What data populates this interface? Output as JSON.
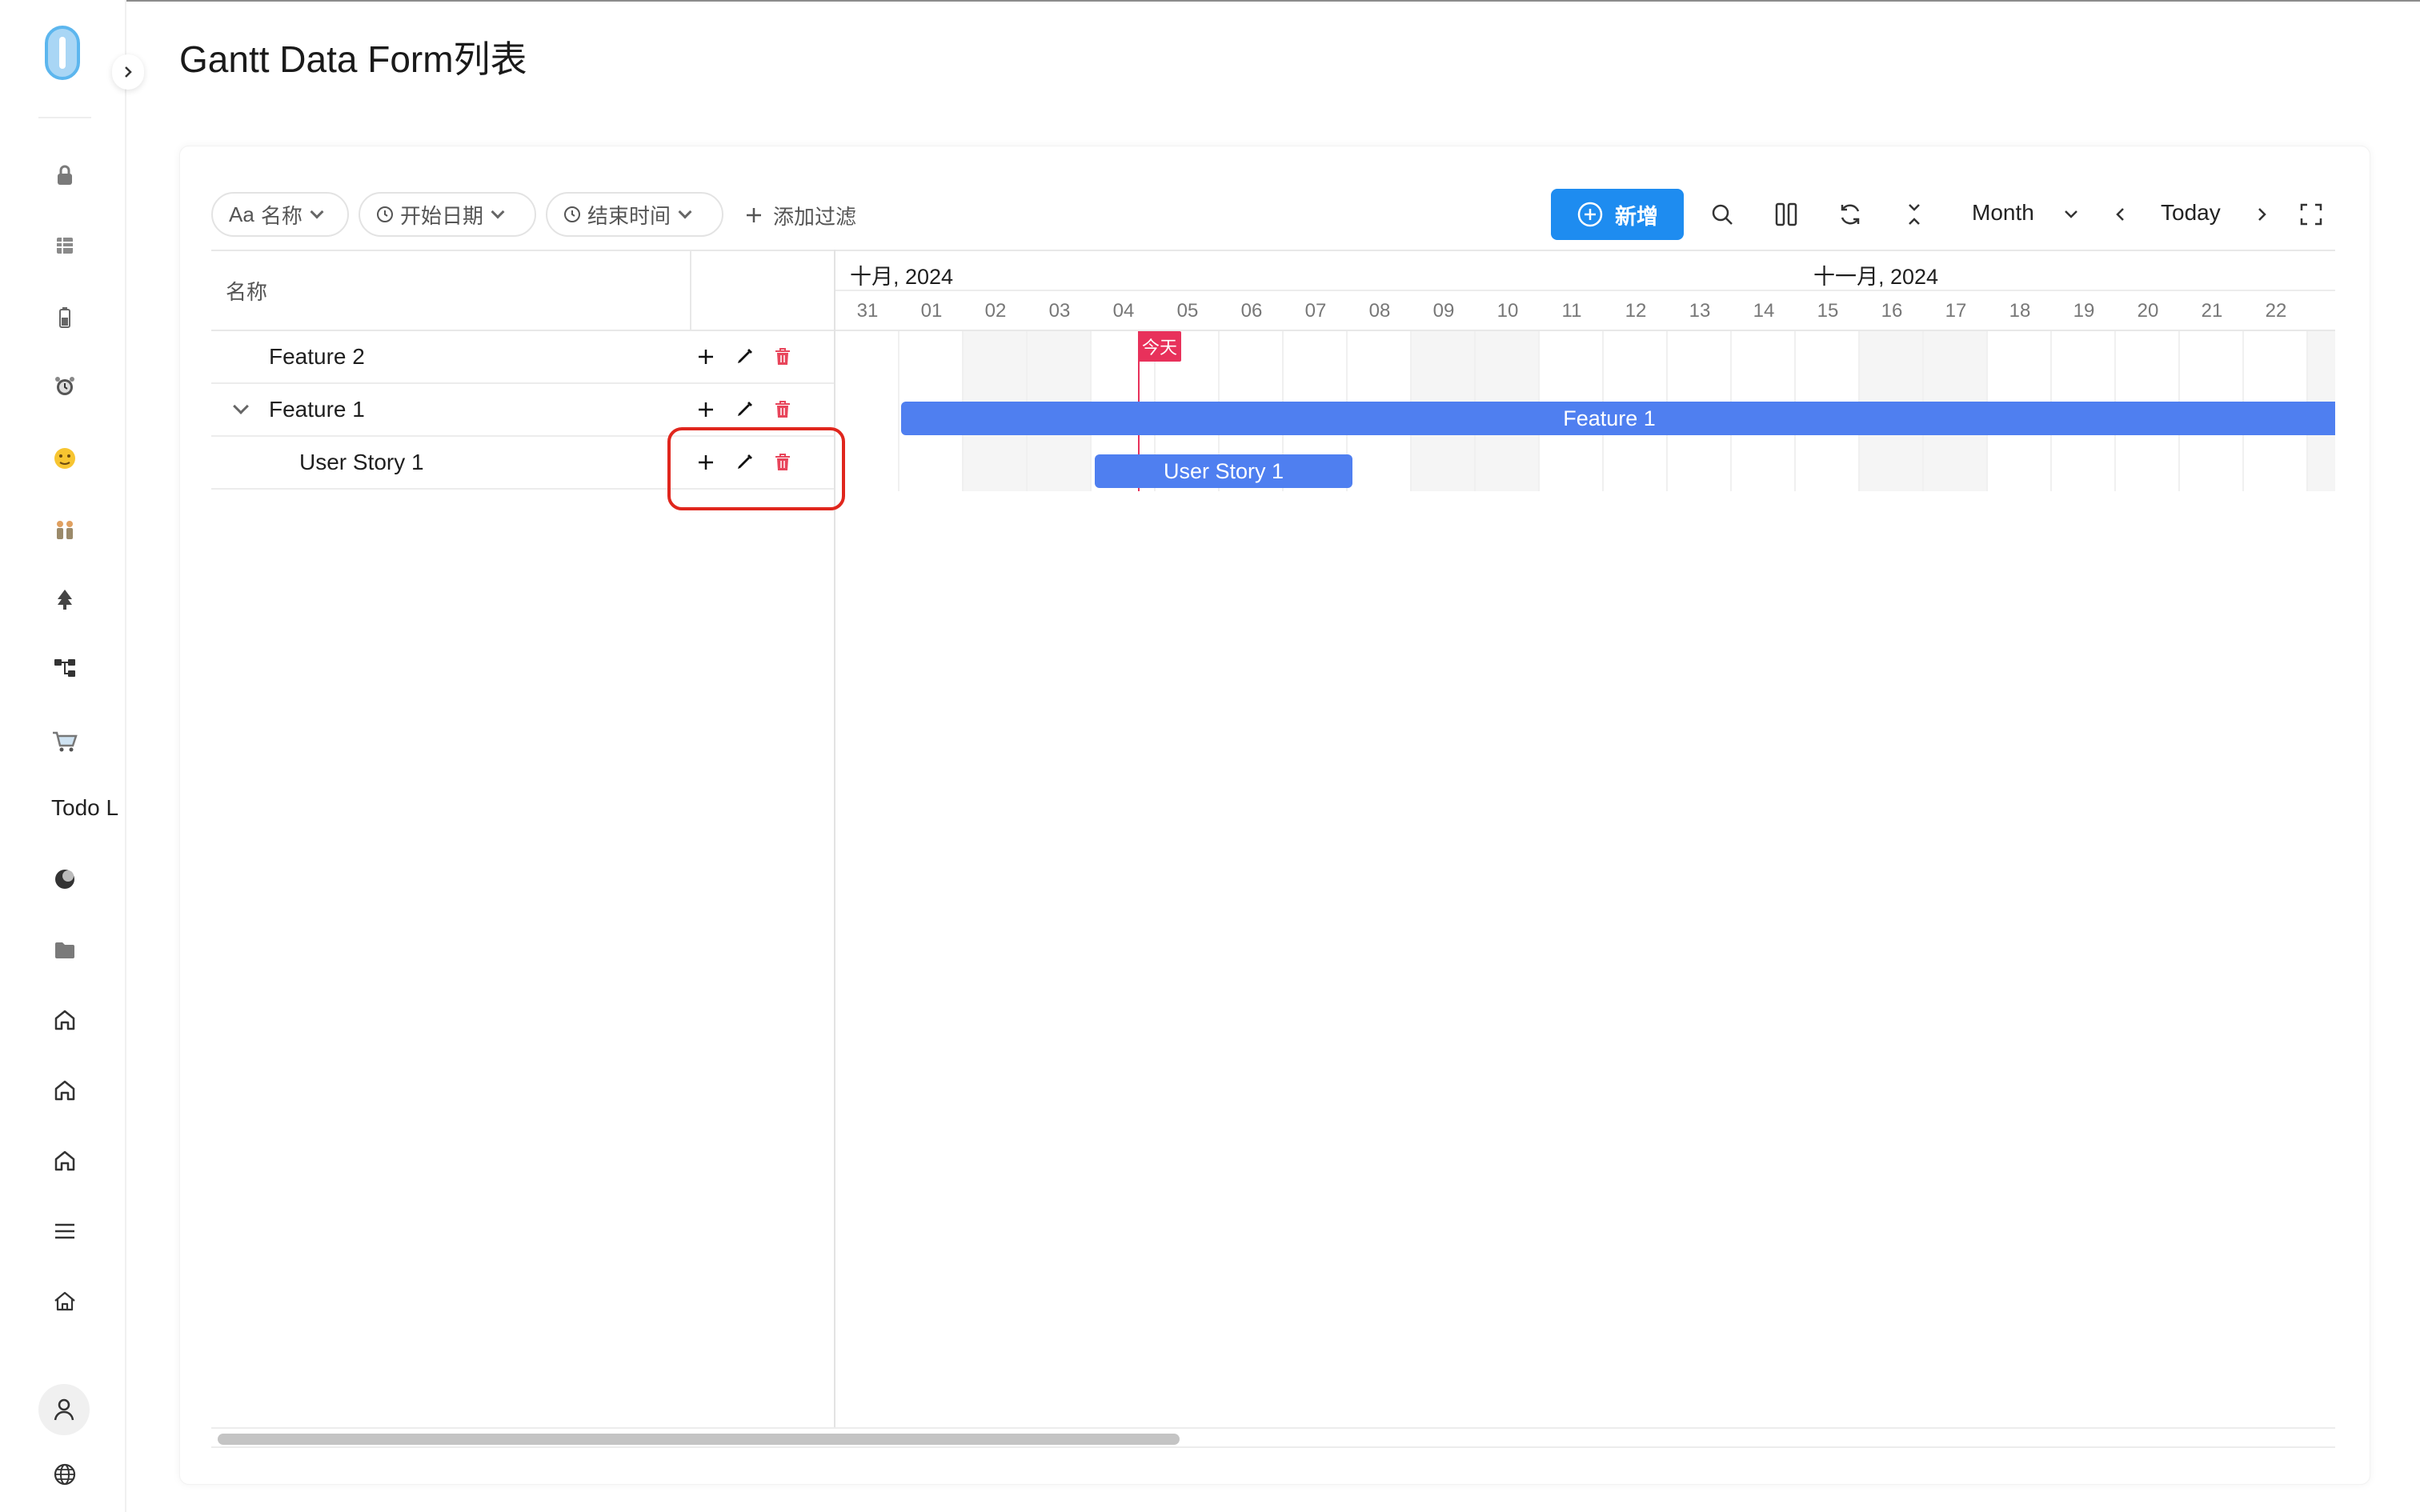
{
  "page": {
    "title": "Gantt Data Form列表"
  },
  "sidebar": {
    "text_item": "Todo L",
    "icons": [
      "lock-icon",
      "table-icon",
      "battery-icon",
      "alarm-clock-icon",
      "face-emoji-icon",
      "people-icon",
      "tree-icon",
      "hierarchy-icon",
      "shopping-cart-icon",
      "moon-icon",
      "folder-icon",
      "home-icon",
      "home-icon",
      "home-icon",
      "menu-icon",
      "house-icon",
      "user-icon",
      "globe-icon"
    ]
  },
  "toolbar": {
    "filters": [
      {
        "prefix": "Aa",
        "label": "名称",
        "icon": "text-type-icon"
      },
      {
        "label": "开始日期",
        "icon": "clock-icon"
      },
      {
        "label": "结束时间",
        "icon": "clock-icon"
      }
    ],
    "add_filter": "添加过滤",
    "new_button": "新增",
    "view_mode": "Month",
    "today_button": "Today"
  },
  "gantt": {
    "name_column_header": "名称",
    "rows": [
      {
        "label": "Feature 2",
        "expandable": false
      },
      {
        "label": "Feature 1",
        "expandable": true,
        "expanded": true
      },
      {
        "label": "User Story 1",
        "expandable": false
      }
    ],
    "months": [
      "十月, 2024",
      "十一月, 2024"
    ],
    "days": [
      "31",
      "01",
      "02",
      "03",
      "04",
      "05",
      "06",
      "07",
      "08",
      "09",
      "10",
      "11",
      "12",
      "13",
      "14",
      "15",
      "16",
      "17",
      "18",
      "19",
      "20",
      "21",
      "22",
      "2"
    ],
    "today_marker": "今天",
    "bars": [
      {
        "label": "Feature 1",
        "start": "2024-11-01",
        "end": "beyond visible range"
      },
      {
        "label": "User Story 1",
        "start": "2024-11-04",
        "end": "2024-11-07"
      }
    ]
  },
  "colors": {
    "primary": "#1e8cf0",
    "bar": "#4f7ff0",
    "today": "#e8315b",
    "delete": "#e8455b",
    "highlight": "#e0261d"
  }
}
